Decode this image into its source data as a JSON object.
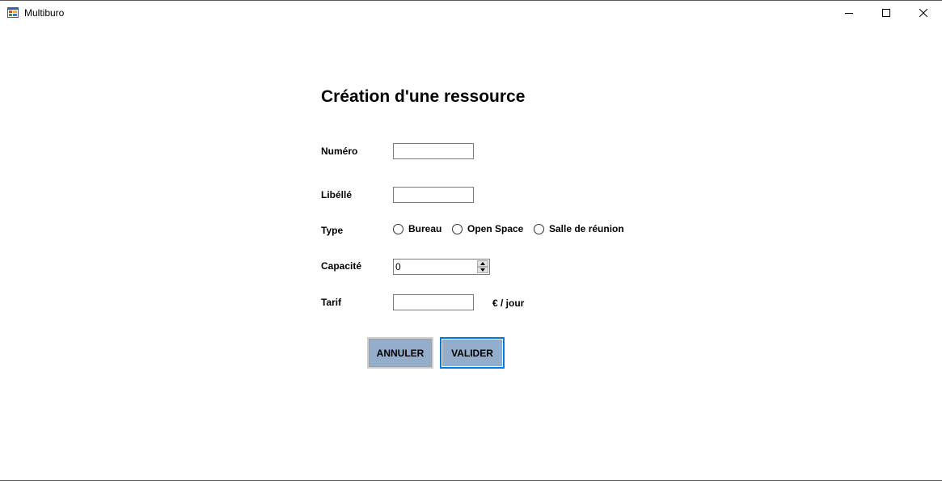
{
  "window": {
    "title": "Multiburo",
    "icons": {
      "app": "app-icon",
      "minimize": "minimize-icon",
      "maximize": "maximize-icon",
      "close": "close-icon"
    }
  },
  "form": {
    "title": "Création d'une ressource",
    "numero": {
      "label": "Numéro",
      "value": ""
    },
    "libelle": {
      "label": "Libéllé",
      "value": ""
    },
    "type": {
      "label": "Type",
      "options": [
        "Bureau",
        "Open Space",
        "Salle de réunion"
      ],
      "selected": null
    },
    "capacite": {
      "label": "Capacité",
      "value": "0"
    },
    "tarif": {
      "label": "Tarif",
      "value": "",
      "unit": "€ / jour"
    },
    "buttons": {
      "cancel": "ANNULER",
      "submit": "VALIDER"
    }
  },
  "colors": {
    "button_bg": "#94adcb",
    "focus_border": "#0078d7"
  }
}
